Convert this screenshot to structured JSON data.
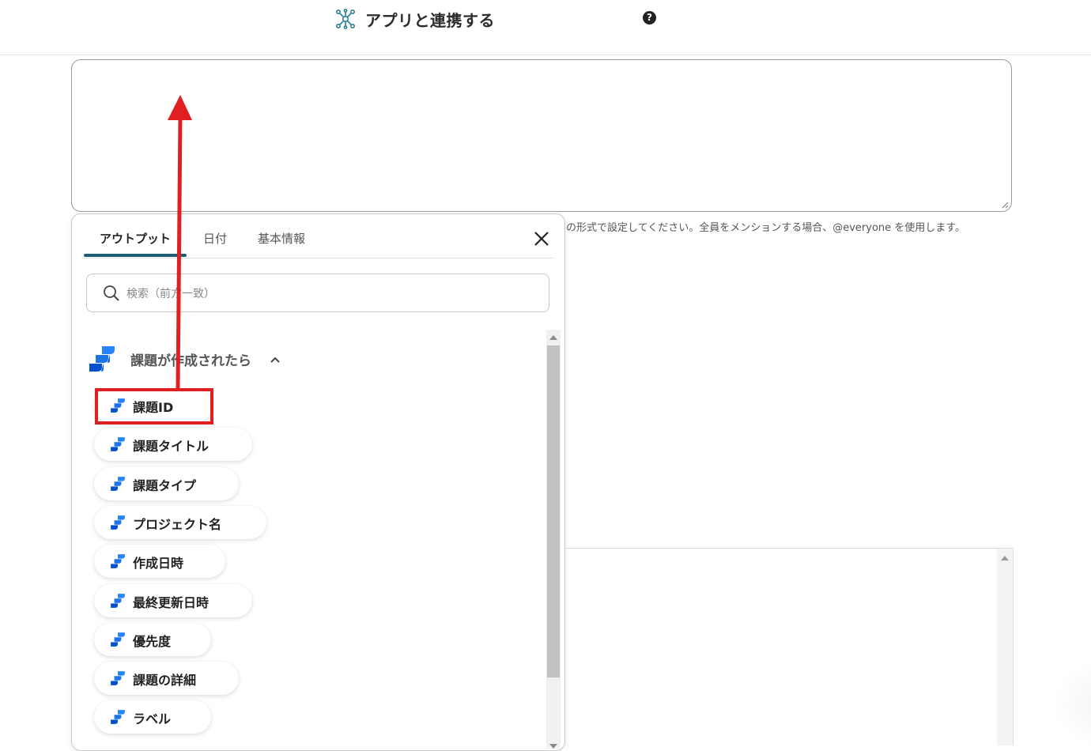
{
  "header": {
    "title": "アプリと連携する",
    "help_label": "?",
    "hub_icon": "hub-network-icon"
  },
  "message_field": {
    "value": "",
    "hint": "の形式で設定してください。全員をメンションする場合、@everyone を使用します。"
  },
  "popup": {
    "tabs": [
      {
        "label": "アウトプット",
        "active": true
      },
      {
        "label": "日付",
        "active": false
      },
      {
        "label": "基本情報",
        "active": false
      }
    ],
    "close_icon": "close-icon",
    "search": {
      "placeholder": "検索（前方一致）",
      "value": ""
    },
    "section": {
      "title": "課題が作成されたら",
      "icon": "jira-icon",
      "expanded": true
    },
    "items": [
      {
        "label": "課題ID",
        "highlighted": true
      },
      {
        "label": "課題タイトル"
      },
      {
        "label": "課題タイプ"
      },
      {
        "label": "プロジェクト名"
      },
      {
        "label": "作成日時"
      },
      {
        "label": "最終更新日時"
      },
      {
        "label": "優先度"
      },
      {
        "label": "課題の詳細"
      },
      {
        "label": "ラベル"
      }
    ]
  },
  "annotation": {
    "highlight_color": "#e02020",
    "arrow_color": "#e02020"
  },
  "colors": {
    "tab_accent": "#1f5f73",
    "jira_blue": "#2684ff"
  }
}
